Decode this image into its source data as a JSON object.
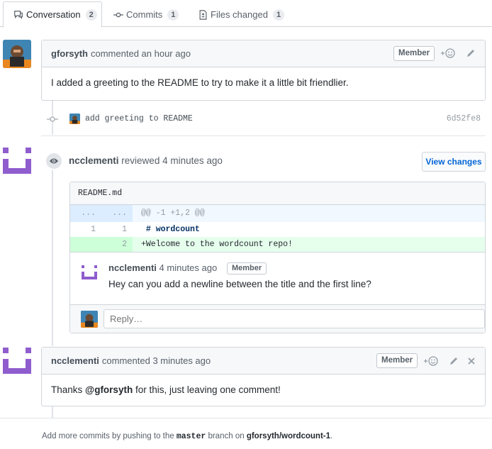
{
  "tabs": [
    {
      "label": "Conversation",
      "count": "2"
    },
    {
      "label": "Commits",
      "count": "1"
    },
    {
      "label": "Files changed",
      "count": "1"
    }
  ],
  "comment1": {
    "author": "gforsyth",
    "meta": "commented an hour ago",
    "badge": "Member",
    "body": "I added a greeting to the README to try to make it a little bit friendlier."
  },
  "commit": {
    "message": "add greeting to README",
    "sha": "6d52fe8"
  },
  "review": {
    "author": "ncclementi",
    "meta": "reviewed 4 minutes ago",
    "view_changes": "View changes",
    "file": "README.md",
    "hunk": {
      "left": "...",
      "right": "...",
      "text": "@@ -1 +1,2 @@"
    },
    "lines": [
      {
        "left": "1",
        "right": "1",
        "text": " # wordcount",
        "type": "context"
      },
      {
        "left": "",
        "right": "2",
        "text": "+Welcome to the wordcount repo!",
        "type": "add"
      }
    ],
    "inline_comment": {
      "author": "ncclementi",
      "meta": "4 minutes ago",
      "badge": "Member",
      "body": "Hey can you add a newline between the title and the first line?"
    },
    "reply_placeholder": "Reply…"
  },
  "comment2": {
    "author": "ncclementi",
    "meta": "commented 3 minutes ago",
    "badge": "Member",
    "body_prefix": "Thanks ",
    "mention": "@gforsyth",
    "body_suffix": " for this, just leaving one comment!"
  },
  "footer": {
    "prefix": "Add more commits by pushing to the ",
    "branch": "master",
    "middle": " branch on ",
    "repo": "gforsyth/wordcount-1",
    "suffix": "."
  },
  "colors": {
    "accent": "#0366d6",
    "identicon": "#8f5dce",
    "added_bg": "#e6ffed"
  },
  "icons": [
    "conversation-icon",
    "commit-icon",
    "file-diff-icon",
    "smiley-icon",
    "pencil-icon",
    "close-icon",
    "eye-icon"
  ]
}
